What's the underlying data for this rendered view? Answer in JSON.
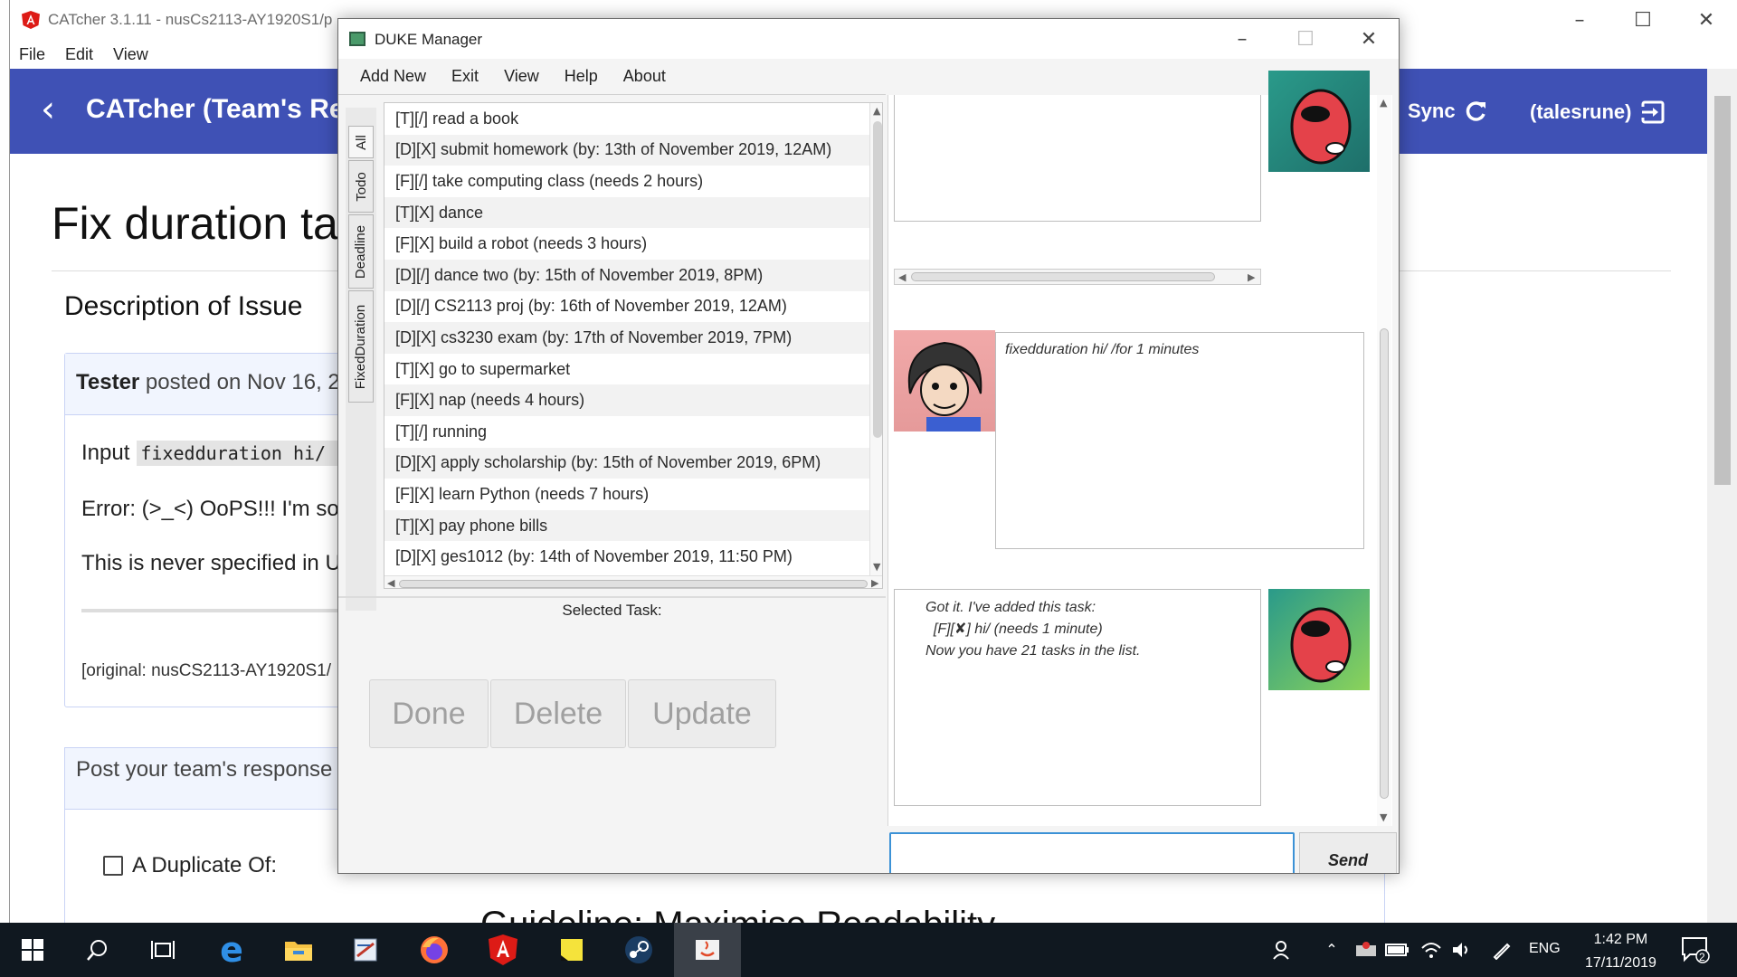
{
  "background_window": {
    "title": "CATcher 3.1.11 - nusCs2113-AY1920S1/p",
    "menu": [
      "File",
      "Edit",
      "View"
    ],
    "app_title": "CATcher  (Team's Res",
    "sync_label": "Sync",
    "user_label": "(talesrune)",
    "issue_title": "Fix duration ta",
    "description_heading": "Description of Issue",
    "card_author": "Tester",
    "card_posted": " posted on Nov 16, 2",
    "input_label": "Input",
    "input_code": "fixedduration hi/ /",
    "error_text": "Error: (>_<) OoPS!!! I'm so",
    "never_text": "This is never specified in U",
    "original_text": "[original: nusCS2113-AY1920S1/",
    "response_title": "Post your team's response",
    "duplicate_label": "A Duplicate Of:",
    "guideline_text": "Guideline: Maximise Readability",
    "accent_color": "#3f51b5"
  },
  "duke": {
    "title": "DUKE Manager",
    "menu": [
      "Add New",
      "Exit",
      "View",
      "Help",
      "About"
    ],
    "tabs": [
      "All",
      "Todo",
      "Deadline",
      "FixedDuration"
    ],
    "tasks": [
      "[T][/] read a book",
      "[D][X] submit homework (by: 13th of November 2019, 12AM)",
      "[F][/] take computing class (needs 2 hours)",
      "[T][X] dance",
      "[F][X] build a robot (needs 3 hours)",
      "[D][/] dance two (by: 15th of November 2019, 8PM)",
      "[D][/] CS2113 proj (by: 16th of November 2019, 12AM)",
      "[D][X] cs3230 exam (by: 17th of November 2019, 7PM)",
      "[T][X] go to supermarket",
      "[F][X] nap (needs 4 hours)",
      "[T][/] running",
      "[D][X] apply scholarship (by: 15th of November 2019, 6PM)",
      "[F][X] learn Python (needs 7 hours)",
      "[T][X] pay phone bills",
      "[D][X] ges1012 (by: 14th of November 2019, 11:50 PM)"
    ],
    "selected_label": "Selected Task:",
    "buttons": {
      "done": "Done",
      "delete": "Delete",
      "update": "Update"
    },
    "chat": {
      "user_message": "fixedduration hi/ /for 1 minutes",
      "bot_line1": "Got it. I've added this task:",
      "bot_line2": "  [F][✘] hi/ (needs 1 minute)",
      "bot_line3": "Now you have 21 tasks in the list."
    },
    "send_label": "Send",
    "input_value": ""
  },
  "taskbar": {
    "time": "1:42 PM",
    "date": "17/11/2019",
    "lang": "ENG",
    "notification_count": "2"
  }
}
